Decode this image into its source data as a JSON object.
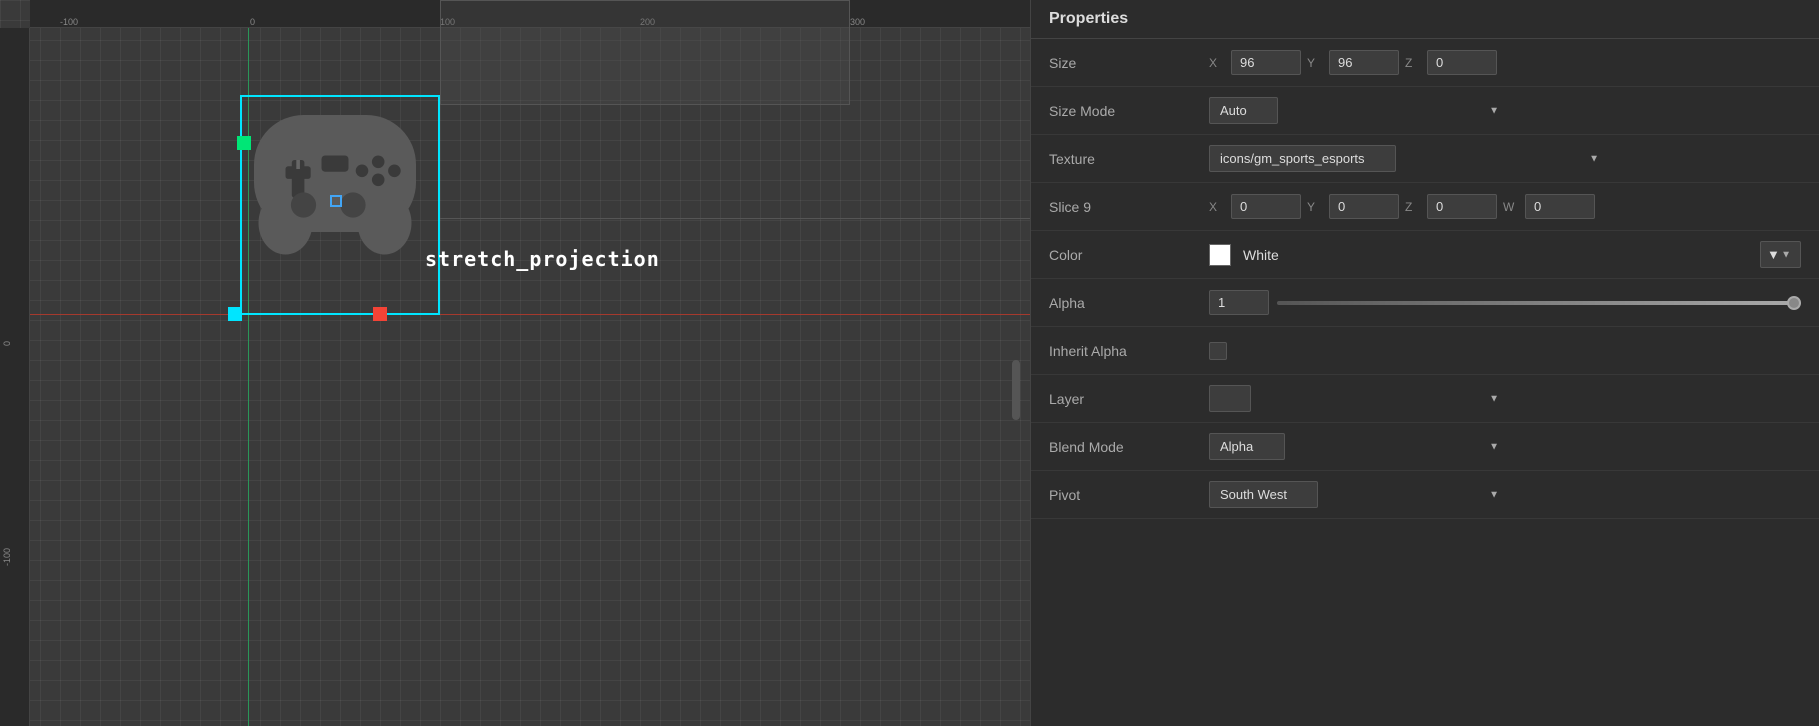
{
  "panel": {
    "title": "Properties",
    "size_label": "Size",
    "size_x_label": "X",
    "size_x_val": "96",
    "size_y_label": "Y",
    "size_y_val": "96",
    "size_z_label": "Z",
    "size_z_val": "0",
    "size_mode_label": "Size Mode",
    "size_mode_val": "Auto",
    "texture_label": "Texture",
    "texture_val": "icons/gm_sports_esports",
    "slice9_label": "Slice 9",
    "slice9_x_label": "X",
    "slice9_x_val": "0",
    "slice9_y_label": "Y",
    "slice9_y_val": "0",
    "slice9_z_label": "Z",
    "slice9_z_val": "0",
    "slice9_w_label": "W",
    "slice9_w_val": "0",
    "color_label": "Color",
    "color_name": "White",
    "color_hex": "#ffffff",
    "alpha_label": "Alpha",
    "alpha_val": "1",
    "inherit_alpha_label": "Inherit Alpha",
    "layer_label": "Layer",
    "layer_val": "",
    "blend_mode_label": "Blend Mode",
    "blend_mode_val": "Alpha",
    "pivot_label": "Pivot",
    "pivot_val": "South West"
  },
  "canvas": {
    "label_stretch": "stretch_projection",
    "ruler_ticks_h": [
      "-100",
      "0",
      "100",
      "200",
      "300"
    ],
    "ruler_ticks_v": [
      "-100"
    ]
  }
}
